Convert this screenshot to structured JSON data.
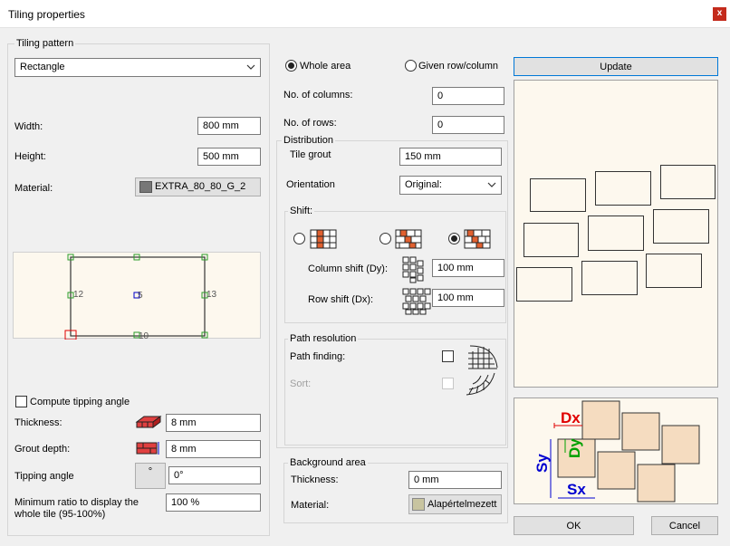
{
  "window": {
    "title": "Tiling properties",
    "close": "x"
  },
  "tiling_pattern": {
    "label": "Tiling pattern",
    "selected": "Rectangle",
    "width_label": "Width:",
    "width_value": "800 mm",
    "height_label": "Height:",
    "height_value": "500 mm",
    "material_label": "Material:",
    "material_value": "EXTRA_80_80_G_2",
    "points": {
      "left": "12",
      "center": "5",
      "right": "13",
      "bottom": "10"
    },
    "compute_tipping_label": "Compute tipping angle",
    "thickness_label": "Thickness:",
    "thickness_value": "8 mm",
    "grout_depth_label": "Grout depth:",
    "grout_depth_value": "8 mm",
    "tipping_angle_label": "Tipping angle",
    "tipping_angle_value": "0°",
    "tipping_angle_icon": "°",
    "min_ratio_label": "Minimum ratio to display the whole tile (95-100%)",
    "min_ratio_value": "100 %"
  },
  "area": {
    "whole_area_label": "Whole area",
    "given_row_label": "Given row/column",
    "columns_label": "No. of columns:",
    "columns_value": "0",
    "rows_label": "No. of rows:",
    "rows_value": "0"
  },
  "distribution": {
    "label": "Distribution",
    "tile_grout_label": "Tile grout",
    "tile_grout_value": "150 mm",
    "orientation_label": "Orientation",
    "orientation_value": "Original:",
    "shift_label": "Shift:",
    "column_shift_label": "Column shift (Dy):",
    "column_shift_value": "100 mm",
    "row_shift_label": "Row shift (Dx):",
    "row_shift_value": "100 mm"
  },
  "path_resolution": {
    "label": "Path resolution",
    "path_finding_label": "Path finding:",
    "sort_label": "Sort:"
  },
  "background": {
    "label": "Background area",
    "thickness_label": "Thickness:",
    "thickness_value": "0 mm",
    "material_label": "Material:",
    "material_value": "Alapértelmezett"
  },
  "preview": {
    "update_label": "Update",
    "diagram": {
      "dx": "Dx",
      "dy": "Dy",
      "sx": "Sx",
      "sy": "Sy"
    }
  },
  "buttons": {
    "ok": "OK",
    "cancel": "Cancel"
  },
  "colors": {
    "dx_label": "#e00000",
    "dy_label": "#00a000",
    "sx_sy_label": "#0000d0",
    "preview_bg": "#fdf8ee",
    "close": "#c42b1c"
  }
}
